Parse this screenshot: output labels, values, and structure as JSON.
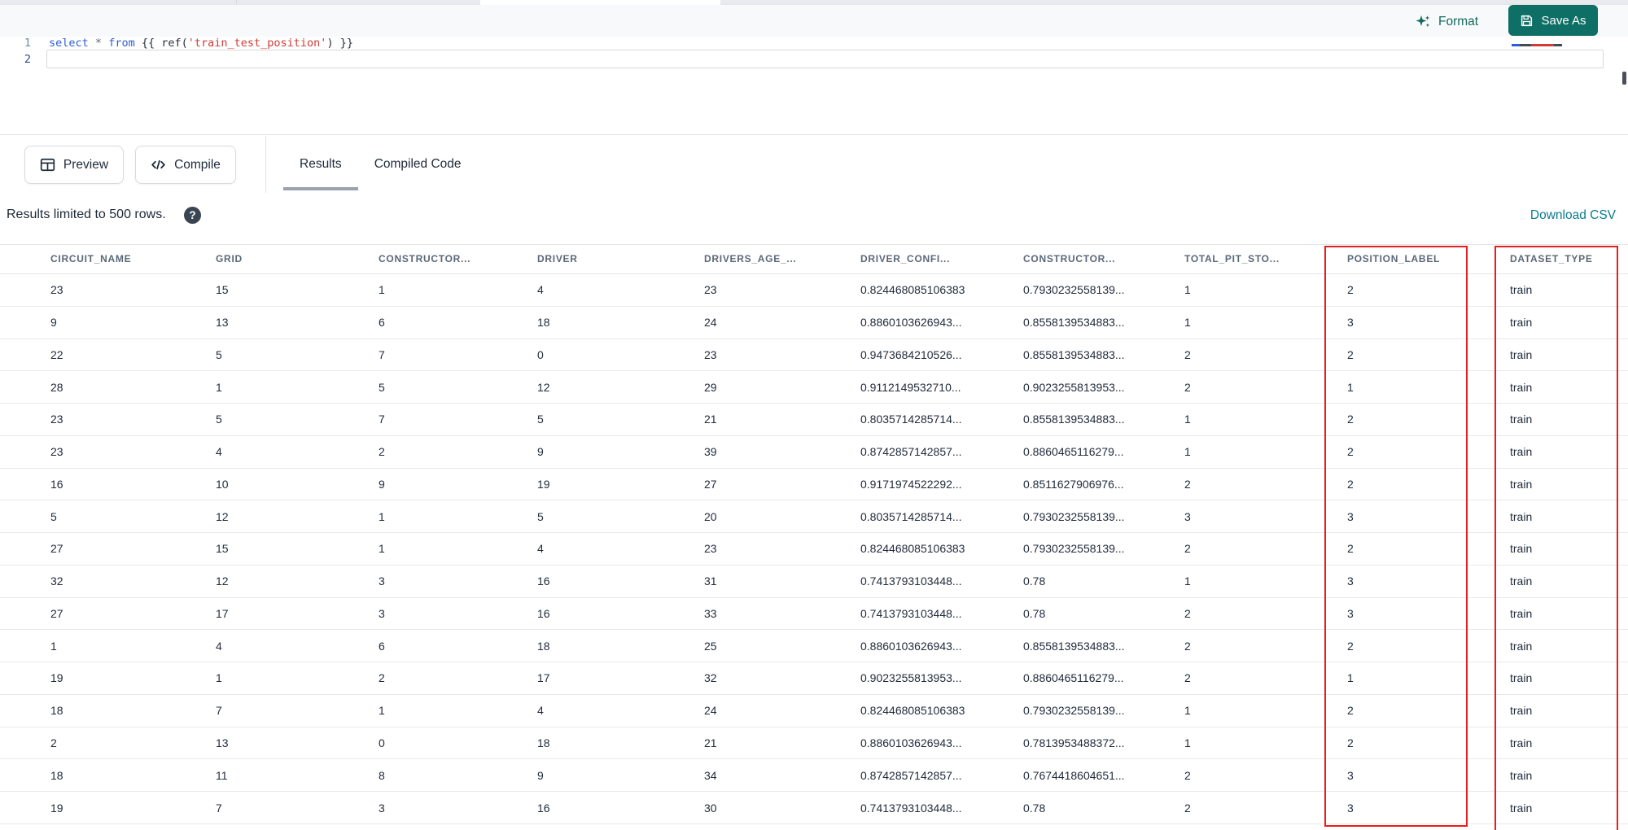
{
  "toolbar": {
    "format_label": "Format",
    "save_as_label": "Save As"
  },
  "editor": {
    "line_numbers": [
      "1",
      "2"
    ],
    "code_tokens": [
      {
        "t": "select",
        "c": "kw"
      },
      {
        "t": " ",
        "c": "plain"
      },
      {
        "t": "*",
        "c": "op"
      },
      {
        "t": " ",
        "c": "plain"
      },
      {
        "t": "from",
        "c": "kw"
      },
      {
        "t": " {{ ",
        "c": "plain"
      },
      {
        "t": "ref(",
        "c": "plain"
      },
      {
        "t": "'train_test_position'",
        "c": "str"
      },
      {
        "t": ") }}",
        "c": "plain"
      }
    ]
  },
  "actions": {
    "preview_label": "Preview",
    "compile_label": "Compile"
  },
  "tabs": [
    {
      "label": "Results",
      "active": true
    },
    {
      "label": "Compiled Code",
      "active": false
    }
  ],
  "results_bar": {
    "message": "Results limited to 500 rows.",
    "help_glyph": "?",
    "download_label": "Download CSV"
  },
  "table": {
    "columns": [
      "CIRCUIT_NAME",
      "GRID",
      "CONSTRUCTOR...",
      "DRIVER",
      "DRIVERS_AGE_...",
      "DRIVER_CONFI...",
      "CONSTRUCTOR...",
      "TOTAL_PIT_STO...",
      "POSITION_LABEL",
      "DATASET_TYPE"
    ],
    "rows": [
      [
        "23",
        "15",
        "1",
        "4",
        "23",
        "0.824468085106383",
        "0.7930232558139...",
        "1",
        "2",
        "train"
      ],
      [
        "9",
        "13",
        "6",
        "18",
        "24",
        "0.8860103626943...",
        "0.8558139534883...",
        "1",
        "3",
        "train"
      ],
      [
        "22",
        "5",
        "7",
        "0",
        "23",
        "0.9473684210526...",
        "0.8558139534883...",
        "2",
        "2",
        "train"
      ],
      [
        "28",
        "1",
        "5",
        "12",
        "29",
        "0.9112149532710...",
        "0.9023255813953...",
        "2",
        "1",
        "train"
      ],
      [
        "23",
        "5",
        "7",
        "5",
        "21",
        "0.8035714285714...",
        "0.8558139534883...",
        "1",
        "2",
        "train"
      ],
      [
        "23",
        "4",
        "2",
        "9",
        "39",
        "0.8742857142857...",
        "0.8860465116279...",
        "1",
        "2",
        "train"
      ],
      [
        "16",
        "10",
        "9",
        "19",
        "27",
        "0.9171974522292...",
        "0.8511627906976...",
        "2",
        "2",
        "train"
      ],
      [
        "5",
        "12",
        "1",
        "5",
        "20",
        "0.8035714285714...",
        "0.7930232558139...",
        "3",
        "3",
        "train"
      ],
      [
        "27",
        "15",
        "1",
        "4",
        "23",
        "0.824468085106383",
        "0.7930232558139...",
        "2",
        "2",
        "train"
      ],
      [
        "32",
        "12",
        "3",
        "16",
        "31",
        "0.7413793103448...",
        "0.78",
        "1",
        "3",
        "train"
      ],
      [
        "27",
        "17",
        "3",
        "16",
        "33",
        "0.7413793103448...",
        "0.78",
        "2",
        "3",
        "train"
      ],
      [
        "1",
        "4",
        "6",
        "18",
        "25",
        "0.8860103626943...",
        "0.8558139534883...",
        "2",
        "2",
        "train"
      ],
      [
        "19",
        "1",
        "2",
        "17",
        "32",
        "0.9023255813953...",
        "0.8860465116279...",
        "2",
        "1",
        "train"
      ],
      [
        "18",
        "7",
        "1",
        "4",
        "24",
        "0.824468085106383",
        "0.7930232558139...",
        "1",
        "2",
        "train"
      ],
      [
        "2",
        "13",
        "0",
        "18",
        "21",
        "0.8860103626943...",
        "0.7813953488372...",
        "1",
        "2",
        "train"
      ],
      [
        "18",
        "11",
        "8",
        "9",
        "34",
        "0.8742857142857...",
        "0.7674418604651...",
        "2",
        "3",
        "train"
      ],
      [
        "19",
        "7",
        "3",
        "16",
        "30",
        "0.7413793103448...",
        "0.78",
        "2",
        "3",
        "train"
      ]
    ]
  },
  "annotations": {
    "highlighted_columns": [
      "POSITION_LABEL",
      "DATASET_TYPE"
    ],
    "highlight_color": "#e81d1d"
  },
  "colors": {
    "accent_teal": "#0d6f66",
    "link_teal": "#0c7c8c",
    "keyword_blue": "#2d5dd7",
    "string_red": "#d13b35"
  }
}
